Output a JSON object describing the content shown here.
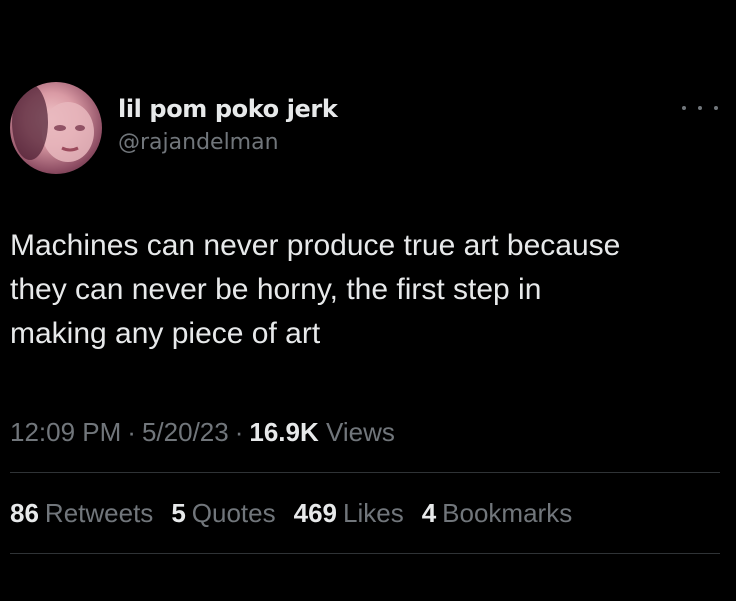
{
  "user": {
    "display_name": "lil pom poko jerk",
    "handle": "@rajandelman",
    "avatar_icon": "profile-photo"
  },
  "more_icon": "more-options-icon",
  "tweet": {
    "lines": [
      "Machines can never produce true art because",
      "they can never be horny, the first step in",
      "making any piece of art"
    ]
  },
  "meta": {
    "time": "12:09 PM",
    "date": "5/20/23",
    "separator": "·",
    "views_count": "16.9K",
    "views_label": "Views"
  },
  "stats": {
    "retweets": {
      "count": "86",
      "label": "Retweets"
    },
    "quotes": {
      "count": "5",
      "label": "Quotes"
    },
    "likes": {
      "count": "469",
      "label": "Likes"
    },
    "bookmarks": {
      "count": "4",
      "label": "Bookmarks"
    }
  },
  "colors": {
    "background": "#000000",
    "primary_text": "#e7e9ea",
    "secondary_text": "#71767b",
    "divider": "#2f3336"
  }
}
